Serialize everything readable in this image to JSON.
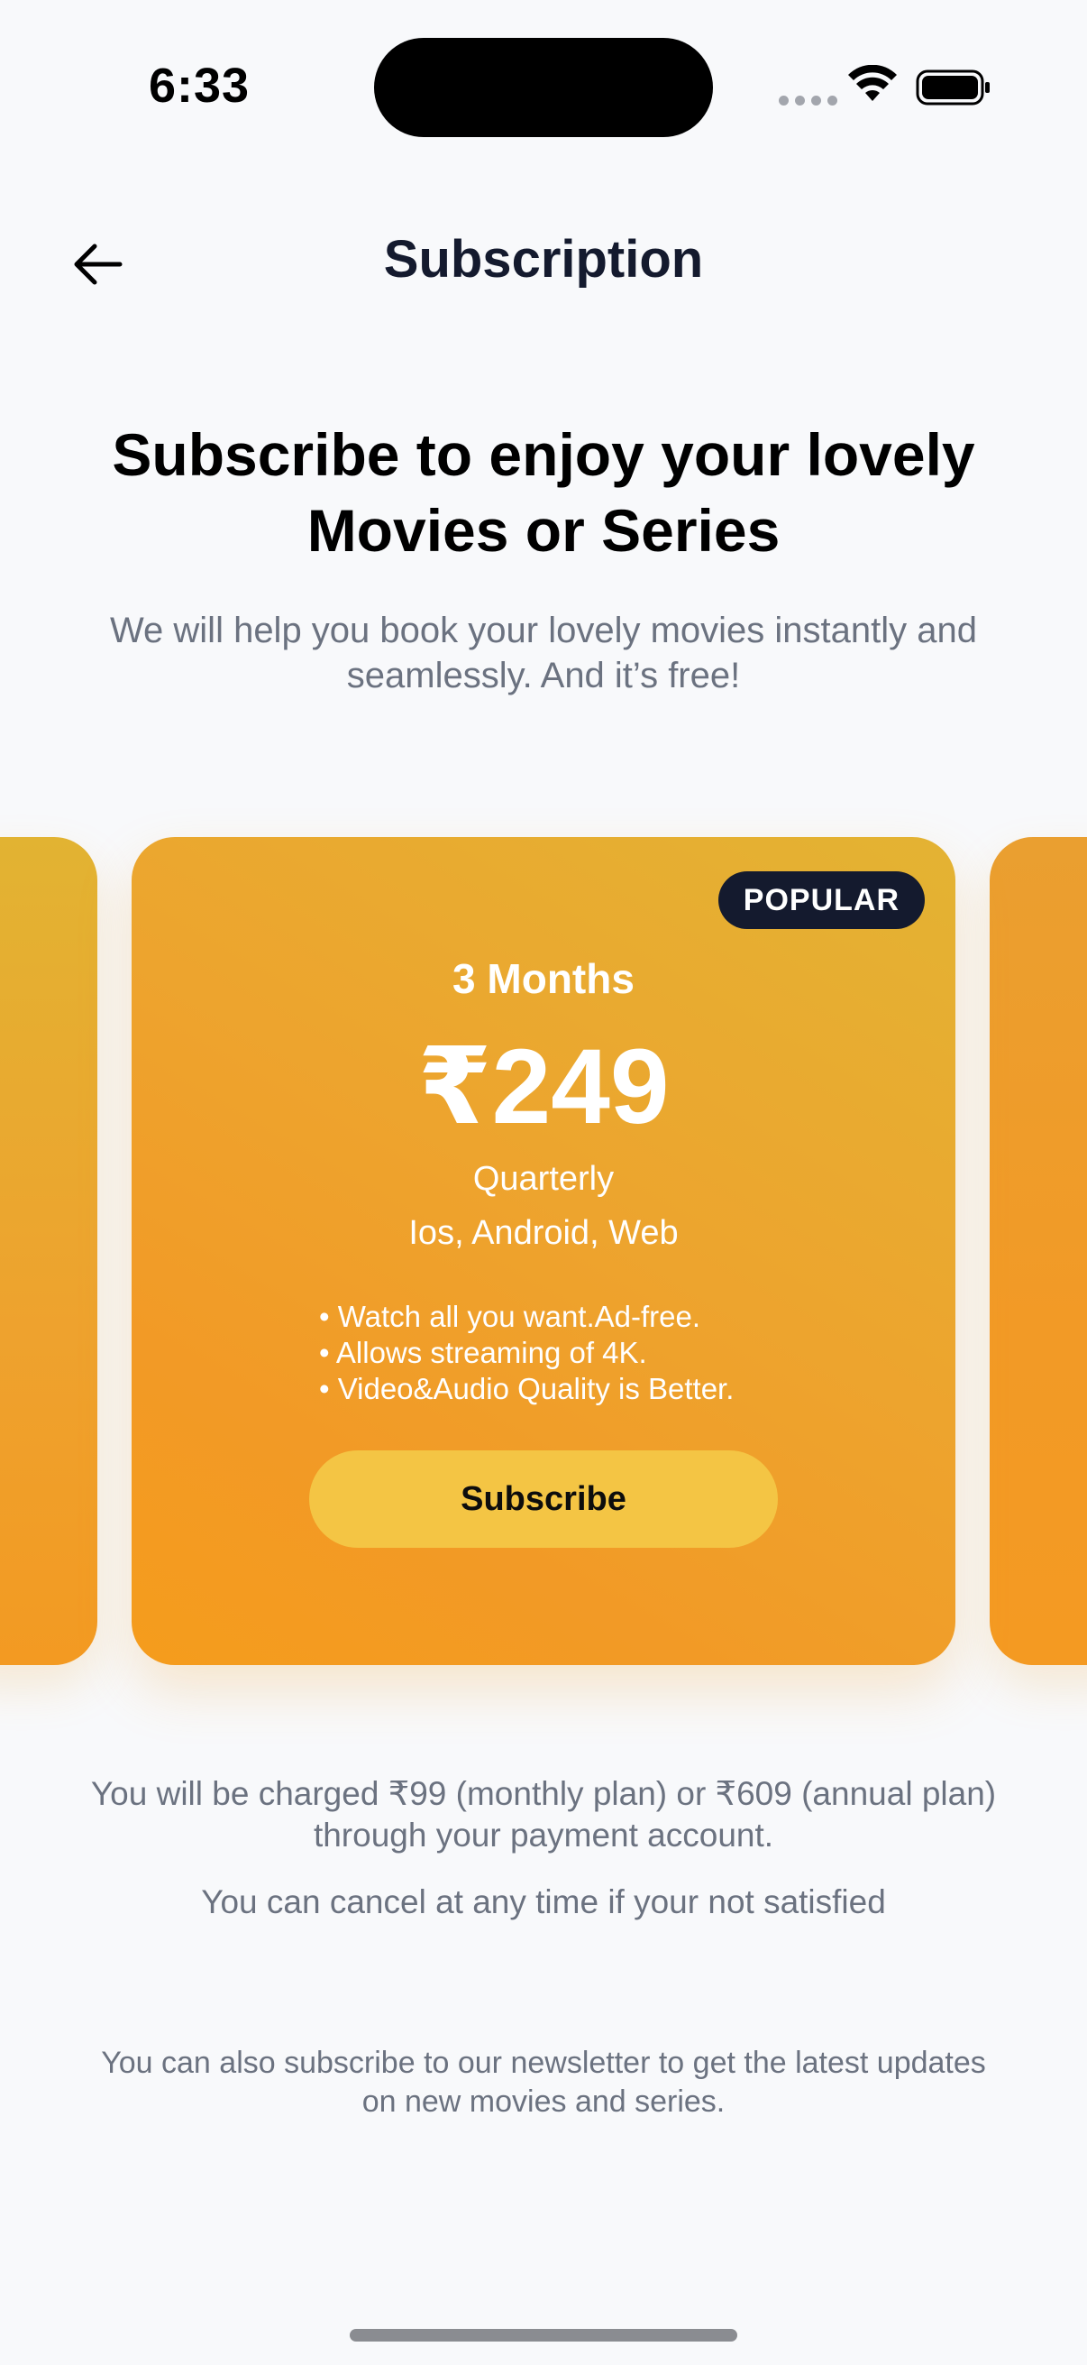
{
  "status_bar": {
    "time": "6:33"
  },
  "header": {
    "back_icon": "arrow-left-icon",
    "title": "Subscription"
  },
  "hero": {
    "heading": "Subscribe to enjoy your lovely Movies or Series",
    "subtitle": "We will help you book your lovely movies instantly and seamlessly. And it’s free!"
  },
  "plan": {
    "badge": "POPULAR",
    "duration": "3 Months",
    "price": "₹249",
    "period": "Quarterly",
    "platforms": "Ios, Android, Web",
    "features": [
      "Watch all you want.Ad-free.",
      "Allows streaming of 4K.",
      "Video&Audio Quality is Better."
    ],
    "cta_label": "Subscribe"
  },
  "footer": {
    "charge_note": "You will be charged ₹99 (monthly plan) or ₹609 (annual plan) through your payment account.",
    "cancel_note": "You can cancel at any time if your not satisfied",
    "newsletter_note": "You can also subscribe to our newsletter to get the latest updates on new movies and series."
  },
  "colors": {
    "card_gradient_top": "#e3b333",
    "card_gradient_bottom": "#f59c1c",
    "badge_bg": "#141a2e",
    "button_bg": "#f4c544",
    "muted_text": "#6b7280"
  }
}
